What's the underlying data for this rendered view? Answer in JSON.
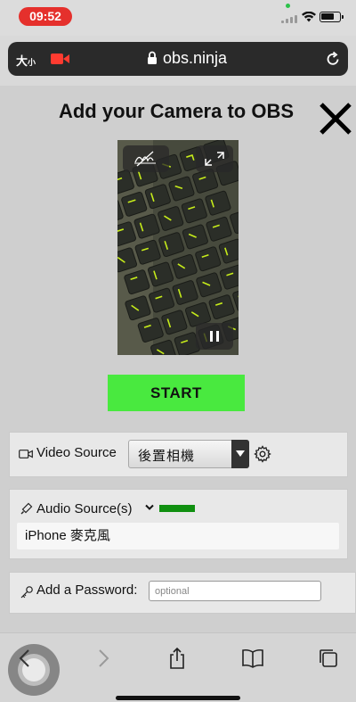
{
  "status_bar": {
    "time": "09:52",
    "time_pill_color": "#e5302c",
    "icons": [
      "signal-icon",
      "wifi-icon",
      "battery-icon"
    ]
  },
  "browser": {
    "text_size_label": "大",
    "text_size_small": "小",
    "url": "obs.ninja",
    "icons": [
      "screen-recording-icon",
      "lock-icon",
      "reload-icon"
    ]
  },
  "page": {
    "title": "Add your Camera to OBS",
    "close_icon": "close-icon",
    "preview_controls": [
      "effects-off-icon",
      "fullscreen-icon",
      "pause-icon"
    ],
    "start_label": "START",
    "start_color": "#49e93f",
    "video_source": {
      "label": "Video Source",
      "selected": "後置相機",
      "icon": "camera-icon",
      "settings_icon": "gear-icon"
    },
    "audio_source": {
      "label": "Audio Source(s)",
      "icon": "microphone-icon",
      "expand_icon": "chevron-down-icon",
      "level_color": "#109010",
      "device": "iPhone 麥克風"
    },
    "password": {
      "label": "Add a Password:",
      "icon": "key-icon",
      "placeholder": "optional",
      "value": ""
    }
  },
  "toolbar": {
    "icons": [
      "back-icon",
      "forward-icon",
      "share-icon",
      "bookmarks-icon",
      "tabs-icon"
    ]
  }
}
